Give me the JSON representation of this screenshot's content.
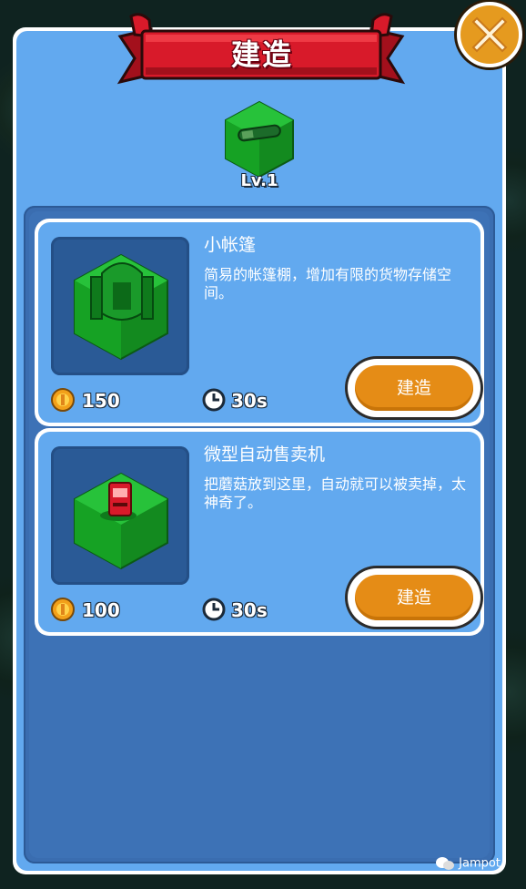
{
  "dialog": {
    "title": "建造",
    "level": "Lv.1"
  },
  "items": [
    {
      "name": "小帐篷",
      "description": "简易的帐篷棚，增加有限的货物存储空间。",
      "cost": "150",
      "time": "30s",
      "build_label": "建造",
      "icon": "tent-icon"
    },
    {
      "name": "微型自动售卖机",
      "description": "把蘑菇放到这里，自动就可以被卖掉，太神奇了。",
      "cost": "100",
      "time": "30s",
      "build_label": "建造",
      "icon": "vending-machine-icon"
    }
  ],
  "watermark": {
    "text": "Jampot"
  },
  "colors": {
    "panel": "#62a9ef",
    "panel_inner": "#3d72b6",
    "ribbon": "#d81a2a",
    "button": "#e58c16",
    "grass": "#1fa82a"
  }
}
